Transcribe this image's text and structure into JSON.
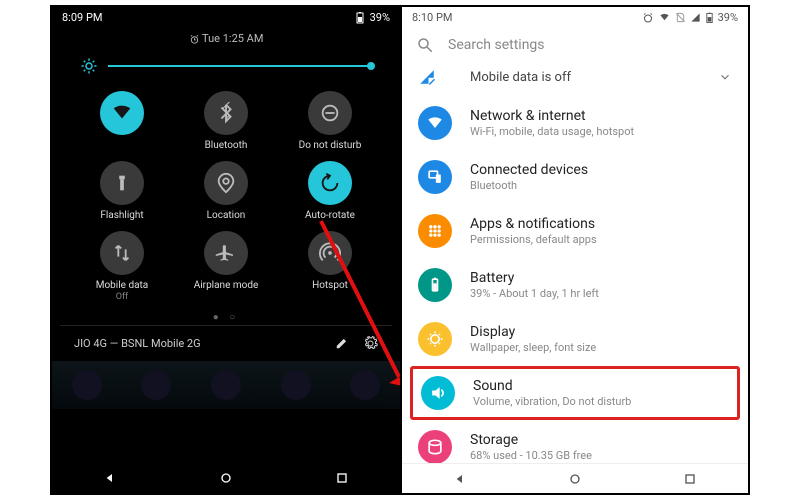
{
  "left": {
    "status": {
      "time": "8:09 PM",
      "battery": "39%"
    },
    "quick_settings": {
      "alarm_text": "Tue 1:25 AM",
      "tiles": [
        {
          "label": "",
          "sub": "",
          "active": true,
          "icon": "wifi"
        },
        {
          "label": "Bluetooth",
          "sub": "",
          "active": false,
          "icon": "bluetooth"
        },
        {
          "label": "Do not disturb",
          "sub": "",
          "active": false,
          "icon": "dnd"
        },
        {
          "label": "Flashlight",
          "sub": "",
          "active": false,
          "icon": "flashlight"
        },
        {
          "label": "Location",
          "sub": "",
          "active": false,
          "icon": "location"
        },
        {
          "label": "Auto-rotate",
          "sub": "",
          "active": true,
          "icon": "rotate"
        },
        {
          "label": "Mobile data",
          "sub": "Off",
          "active": false,
          "icon": "mobiledata"
        },
        {
          "label": "Airplane mode",
          "sub": "",
          "active": false,
          "icon": "airplane"
        },
        {
          "label": "Hotspot",
          "sub": "",
          "active": false,
          "icon": "hotspot"
        }
      ],
      "carrier": "JIO 4G — BSNL Mobile 2G"
    }
  },
  "right": {
    "status": {
      "time": "8:10 PM",
      "battery": "39%"
    },
    "search_placeholder": "Search settings",
    "banner": "Mobile data is off",
    "items": [
      {
        "title": "Network & internet",
        "sub": "Wi-Fi, mobile, data usage, hotspot",
        "color": "#1e88e5",
        "icon": "wifi"
      },
      {
        "title": "Connected devices",
        "sub": "Bluetooth",
        "color": "#1e88e5",
        "icon": "devices"
      },
      {
        "title": "Apps & notifications",
        "sub": "Permissions, default apps",
        "color": "#fb8c00",
        "icon": "apps"
      },
      {
        "title": "Battery",
        "sub": "39% - About 1 day, 1 hr left",
        "color": "#009688",
        "icon": "battery"
      },
      {
        "title": "Display",
        "sub": "Wallpaper, sleep, font size",
        "color": "#fbc02d",
        "icon": "display"
      },
      {
        "title": "Sound",
        "sub": "Volume, vibration, Do not disturb",
        "color": "#00bcd4",
        "icon": "sound",
        "highlight": true
      },
      {
        "title": "Storage",
        "sub": "68% used - 10.35 GB free",
        "color": "#ec407a",
        "icon": "storage"
      }
    ]
  }
}
